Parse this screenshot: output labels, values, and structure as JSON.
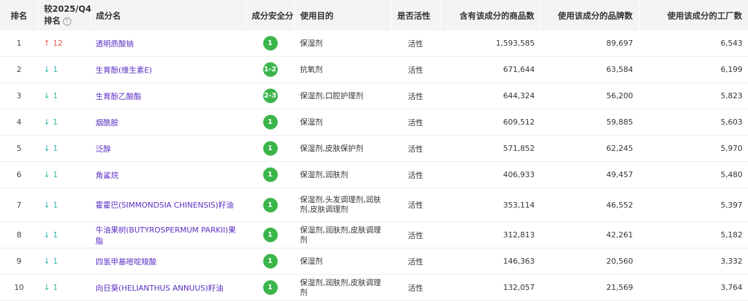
{
  "headers": {
    "rank": "排名",
    "change_line1": "较2025/Q4",
    "change_line2": "排名",
    "help_icon": "?",
    "name": "成分名",
    "safety": "成分安全分",
    "purpose": "使用目的",
    "active": "是否活性",
    "product_count": "含有该成分的商品数",
    "brand_count": "使用该成分的品牌数",
    "factory_count": "使用该成分的工厂数"
  },
  "colors": {
    "up": "#e8514b",
    "down": "#2fb3a6",
    "link": "#5a2fc2",
    "safe_badge": "#3bb54a"
  },
  "rows": [
    {
      "rank": "1",
      "arrow": "↑",
      "change": "12",
      "dir": "up",
      "name": "透明质酸钠",
      "safety": "1",
      "purpose": "保湿剂",
      "active": "活性",
      "products": "1,593,585",
      "brands": "89,697",
      "factories": "6,543"
    },
    {
      "rank": "2",
      "arrow": "↓",
      "change": "1",
      "dir": "down",
      "name": "生育酚(维生素E)",
      "safety": "1-2",
      "purpose": "抗氧剂",
      "active": "活性",
      "products": "671,644",
      "brands": "63,584",
      "factories": "6,199"
    },
    {
      "rank": "3",
      "arrow": "↓",
      "change": "1",
      "dir": "down",
      "name": "生育酚乙酸酯",
      "safety": "2-3",
      "purpose": "保湿剂,口腔护理剂",
      "active": "活性",
      "products": "644,324",
      "brands": "56,200",
      "factories": "5,823"
    },
    {
      "rank": "4",
      "arrow": "↓",
      "change": "1",
      "dir": "down",
      "name": "烟酰胺",
      "safety": "1",
      "purpose": "保湿剂",
      "active": "活性",
      "products": "609,512",
      "brands": "59,885",
      "factories": "5,603"
    },
    {
      "rank": "5",
      "arrow": "↓",
      "change": "1",
      "dir": "down",
      "name": "泛醇",
      "safety": "1",
      "purpose": "保湿剂,皮肤保护剂",
      "active": "活性",
      "products": "571,852",
      "brands": "62,245",
      "factories": "5,970"
    },
    {
      "rank": "6",
      "arrow": "↓",
      "change": "1",
      "dir": "down",
      "name": "角鲨烷",
      "safety": "1",
      "purpose": "保湿剂,润肤剂",
      "active": "活性",
      "products": "406,933",
      "brands": "49,457",
      "factories": "5,480"
    },
    {
      "rank": "7",
      "arrow": "↓",
      "change": "1",
      "dir": "down",
      "name": "霍霍巴(SIMMONDSIA CHINENSIS)籽油",
      "safety": "1",
      "purpose": "保湿剂,头发调理剂,润肤剂,皮肤调理剂",
      "active": "活性",
      "products": "353,114",
      "brands": "46,552",
      "factories": "5,397"
    },
    {
      "rank": "8",
      "arrow": "↓",
      "change": "1",
      "dir": "down",
      "name": "牛油果树(BUTYROSPERMUM PARKII)果脂",
      "safety": "1",
      "purpose": "保湿剂,润肤剂,皮肤调理剂",
      "active": "活性",
      "products": "312,813",
      "brands": "42,261",
      "factories": "5,182"
    },
    {
      "rank": "9",
      "arrow": "↓",
      "change": "1",
      "dir": "down",
      "name": "四氢甲基嘧啶羧酸",
      "safety": "1",
      "purpose": "保湿剂",
      "active": "活性",
      "products": "146,363",
      "brands": "20,560",
      "factories": "3,332"
    },
    {
      "rank": "10",
      "arrow": "↓",
      "change": "1",
      "dir": "down",
      "name": "向日葵(HELIANTHUS ANNUUS)籽油",
      "safety": "1",
      "purpose": "保湿剂,润肤剂,皮肤调理剂",
      "active": "活性",
      "products": "132,057",
      "brands": "21,569",
      "factories": "3,764"
    }
  ]
}
